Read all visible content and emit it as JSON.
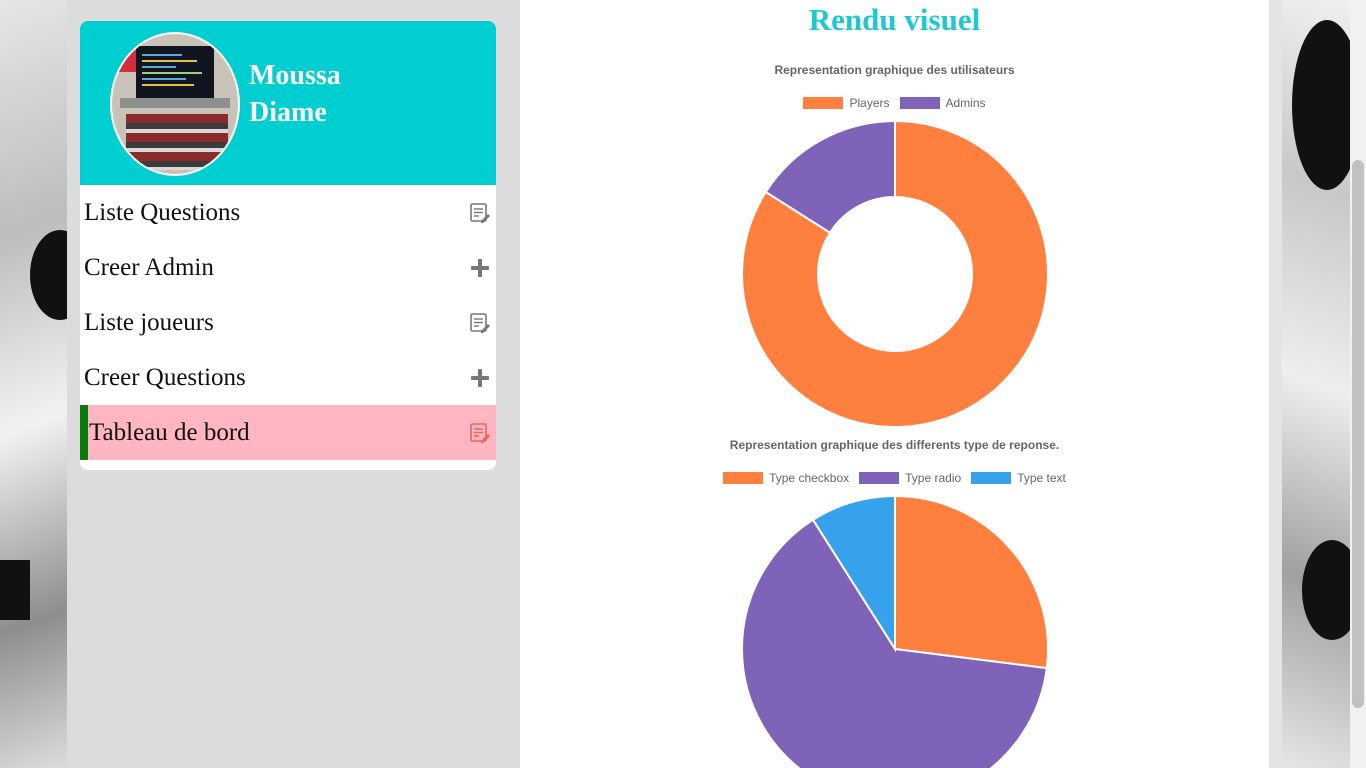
{
  "profile": {
    "name_line1": "Moussa",
    "name_line2": "Diame"
  },
  "menu": [
    {
      "label": "Liste Questions",
      "icon": "edit-list-icon",
      "active": false
    },
    {
      "label": "Creer Admin",
      "icon": "plus-icon",
      "active": false
    },
    {
      "label": "Liste joueurs",
      "icon": "edit-list-icon",
      "active": false
    },
    {
      "label": "Creer Questions",
      "icon": "plus-icon",
      "active": false
    },
    {
      "label": "Tableau de bord",
      "icon": "edit-list-icon",
      "active": true
    }
  ],
  "colors": {
    "accent": "#00ced1",
    "title": "#1ec8d2",
    "active_bg": "#ffb6c1",
    "active_bar": "#0a7a0a",
    "orange": "#ff7f3f",
    "purple": "#7f63b8",
    "blue": "#36a2eb"
  },
  "page_title": "Rendu visuel",
  "chart_data": [
    {
      "type": "pie",
      "variant": "doughnut",
      "title": "Representation graphique des utilisateurs",
      "legend_position": "top",
      "labels": [
        "Players",
        "Admins"
      ],
      "values": [
        84,
        16
      ],
      "colors": [
        "#ff7f3f",
        "#7f63b8"
      ]
    },
    {
      "type": "pie",
      "title": "Representation graphique des differents type de reponse.",
      "legend_position": "top",
      "labels": [
        "Type checkbox",
        "Type radio",
        "Type text"
      ],
      "values": [
        27,
        64,
        9
      ],
      "colors": [
        "#ff7f3f",
        "#7f63b8",
        "#36a2eb"
      ]
    }
  ]
}
